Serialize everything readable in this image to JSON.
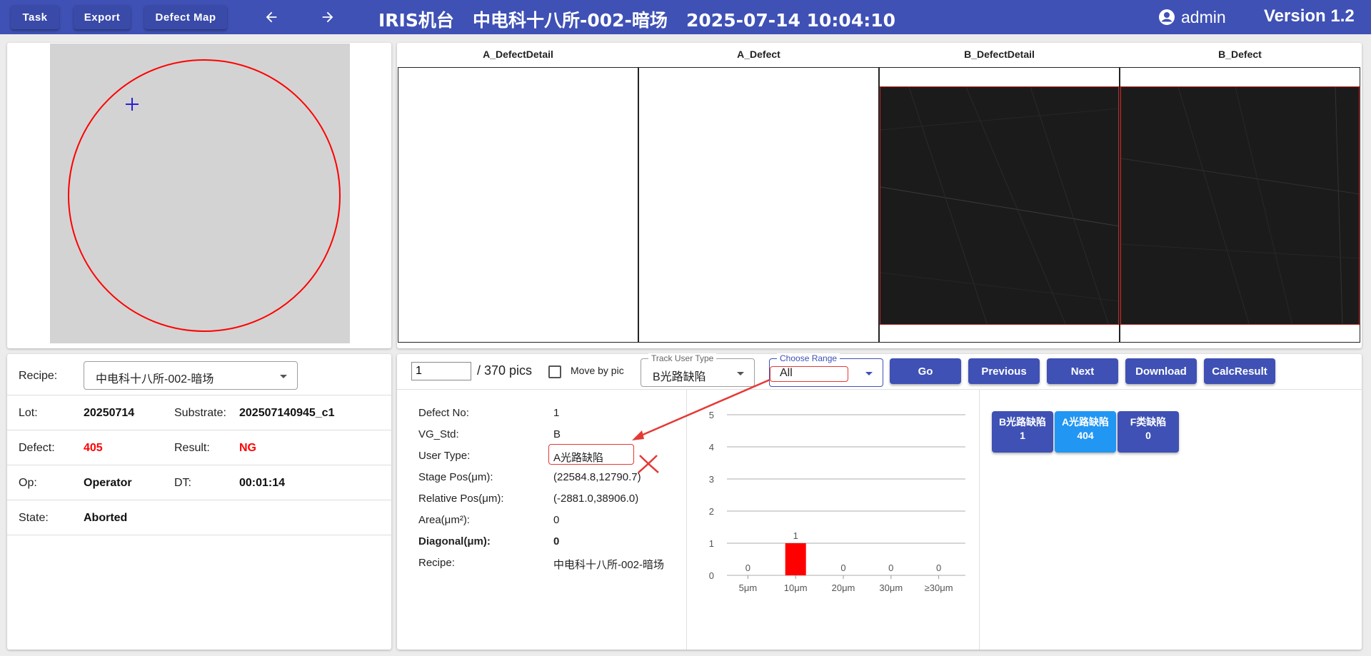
{
  "topbar": {
    "task_label": "Task",
    "export_label": "Export",
    "defect_map_label": "Defect Map",
    "title": "IRIS机台   中电科十八所-002-暗场   2025-07-14 10:04:10",
    "user": "admin",
    "version": "Version 1.2"
  },
  "info": {
    "recipe_label": "Recipe:",
    "recipe_value": "中电科十八所-002-暗场",
    "lot_label": "Lot:",
    "lot_value": "20250714",
    "substrate_label": "Substrate:",
    "substrate_value": "202507140945_c1",
    "defect_label": "Defect:",
    "defect_value": "405",
    "result_label": "Result:",
    "result_value": "NG",
    "op_label": "Op:",
    "op_value": "Operator",
    "dt_label": "DT:",
    "dt_value": "00:01:14",
    "state_label": "State:",
    "state_value": "Aborted"
  },
  "images": {
    "headers": [
      "A_DefectDetail",
      "A_Defect",
      "B_DefectDetail",
      "B_Defect"
    ]
  },
  "controls": {
    "page_value": "1",
    "page_total": "/ 370 pics",
    "move_by_pic_label": "Move by pic",
    "move_by_pic_checked": false,
    "track_user_type_label": "Track User Type",
    "track_user_type_value": "B光路缺陷",
    "choose_range_label": "Choose Range",
    "choose_range_value": "All",
    "go_label": "Go",
    "previous_label": "Previous",
    "next_label": "Next",
    "download_label": "Download",
    "calc_result_label": "CalcResult"
  },
  "detail": {
    "defect_no_label": "Defect No:",
    "defect_no_value": "1",
    "vg_std_label": "VG_Std:",
    "vg_std_value": "B",
    "user_type_label": "User Type:",
    "user_type_value": "A光路缺陷",
    "stage_pos_label": "Stage Pos(μm):",
    "stage_pos_value": "(22584.8,12790.7)",
    "relative_pos_label": "Relative Pos(μm):",
    "relative_pos_value": "(-2881.0,38906.0)",
    "area_label": "Area(μm²):",
    "area_value": "0",
    "diagonal_label": "Diagonal(μm):",
    "diagonal_value": "0",
    "recipe_label": "Recipe:",
    "recipe_value": "中电科十八所-002-暗场"
  },
  "chips": [
    {
      "name": "B光路缺陷",
      "count": "1",
      "color": "#3f51b5"
    },
    {
      "name": "A光路缺陷",
      "count": "404",
      "color": "#2196f3"
    },
    {
      "name": "F类缺陷",
      "count": "0",
      "color": "#3f51b5"
    }
  ],
  "colors": {
    "primary": "#3f51b5",
    "accent_blue": "#2196f3",
    "ng_red": "#ff0000",
    "annotation_red": "#e53935"
  },
  "chart_data": {
    "type": "bar",
    "categories": [
      "5μm",
      "10μm",
      "20μm",
      "30μm",
      "≥30μm"
    ],
    "values": [
      0,
      1,
      0,
      0,
      0
    ],
    "ylim": [
      0,
      5
    ],
    "yticks": [
      0,
      1,
      2,
      3,
      4,
      5
    ],
    "bar_color": "#ff0000",
    "grid": true
  }
}
